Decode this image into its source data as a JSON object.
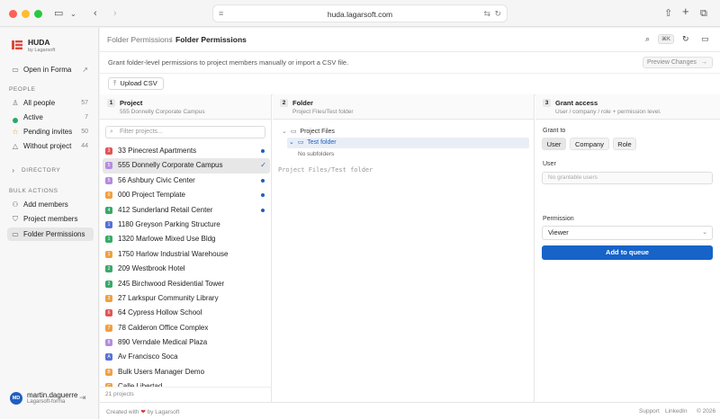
{
  "browser": {
    "url": "huda.lagarsoft.com"
  },
  "sidebar": {
    "brand": "HUDA",
    "brand_sub": "by Lagarsoft",
    "open_in_forma": "Open in Forma",
    "people_heading": "PEOPLE",
    "people": [
      {
        "label": "All people",
        "count": "57",
        "dot": "#cccccc"
      },
      {
        "label": "Active",
        "count": "7",
        "dot": "#2aa86a"
      },
      {
        "label": "Pending invites",
        "count": "50",
        "dot": "#e0a400"
      },
      {
        "label": "Without project",
        "count": "44",
        "dot": "#888888"
      }
    ],
    "directory": "DIRECTORY",
    "bulk_heading": "BULK ACTIONS",
    "bulk": [
      {
        "label": "Add members"
      },
      {
        "label": "Project members"
      },
      {
        "label": "Folder Permissions"
      }
    ],
    "user": {
      "initials": "MD",
      "name": "martin.daguerre",
      "org": "Lagarsoft-forma"
    }
  },
  "topbar": {
    "crumb_parent": "Folder Permissions",
    "crumb_current": "Folder Permissions",
    "shortcut": "⌘K"
  },
  "intro": "Grant folder-level permissions to project members manually or import a CSV file.",
  "preview_label": "Preview Changes",
  "upload_label": "Upload CSV",
  "project_col": {
    "num": "1",
    "title": "Project",
    "sub": "555 Donnelly Corporate Campus",
    "filter_placeholder": "Filter projects...",
    "count": "21 projects",
    "items": [
      {
        "badge": "3",
        "color": "#e05555",
        "name": "33 Pinecrest Apartments",
        "dot": true
      },
      {
        "badge": "5",
        "color": "#b58be0",
        "name": "555 Donnelly Corporate Campus",
        "selected": true
      },
      {
        "badge": "5",
        "color": "#b58be0",
        "name": "56 Ashbury Civic Center",
        "dot": true
      },
      {
        "badge": "0",
        "color": "#f0a040",
        "name": "000 Project Template",
        "dot": true
      },
      {
        "badge": "4",
        "color": "#3aa86a",
        "name": "412 Sunderland Retail Center",
        "dot": true
      },
      {
        "badge": "1",
        "color": "#5570d8",
        "name": "1180 Greyson Parking Structure"
      },
      {
        "badge": "1",
        "color": "#3aa86a",
        "name": "1320 Marlowe Mixed Use Bldg"
      },
      {
        "badge": "1",
        "color": "#f0a040",
        "name": "1750 Harlow Industrial Warehouse"
      },
      {
        "badge": "2",
        "color": "#3aa86a",
        "name": "209 Westbrook Hotel"
      },
      {
        "badge": "2",
        "color": "#3aa86a",
        "name": "245 Birchwood Residential Tower"
      },
      {
        "badge": "2",
        "color": "#f0a040",
        "name": "27 Larkspur Community Library"
      },
      {
        "badge": "6",
        "color": "#e05555",
        "name": "64 Cypress Hollow School"
      },
      {
        "badge": "7",
        "color": "#f0a040",
        "name": "78 Calderon Office Complex"
      },
      {
        "badge": "8",
        "color": "#b58be0",
        "name": "890 Verndale Medical Plaza"
      },
      {
        "badge": "A",
        "color": "#5570d8",
        "name": "Av Francisco Soca"
      },
      {
        "badge": "B",
        "color": "#f0a040",
        "name": "Bulk Users Manager Demo"
      },
      {
        "badge": "C",
        "color": "#f0a040",
        "name": "Calle Libertad"
      }
    ]
  },
  "folder_col": {
    "num": "2",
    "title": "Folder",
    "sub": "Project Files/Test folder",
    "root": "Project Files",
    "selected": "Test folder",
    "empty": "No subfolders",
    "path": "Project Files/Test folder"
  },
  "access_col": {
    "num": "3",
    "title": "Grant access",
    "sub": "User / company / role + permission level.",
    "grant_to": "Grant to",
    "options": [
      "User",
      "Company",
      "Role"
    ],
    "user_label": "User",
    "user_placeholder": "No grantable users",
    "permission_label": "Permission",
    "permission_value": "Viewer",
    "add_label": "Add to queue"
  },
  "footer": {
    "created_pre": "Created with",
    "heart": "❤",
    "created_post": "by Lagarsoft",
    "support": "Support",
    "linkedin": "LinkedIn",
    "copyright": "© 2026"
  }
}
